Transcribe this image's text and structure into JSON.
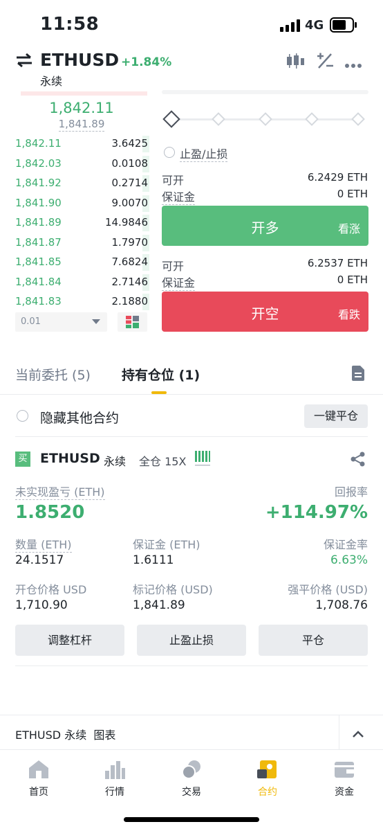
{
  "status_bar": {
    "time": "11:58",
    "network": "4G"
  },
  "header": {
    "pair": "ETHUSD",
    "change": "+1.84%",
    "subtitle": "永续"
  },
  "order_book": {
    "last_price": "1,842.11",
    "mark_price": "1,841.89",
    "bids": [
      {
        "price": "1,842.11",
        "qty": "3.6425",
        "depth": 0.05
      },
      {
        "price": "1,842.03",
        "qty": "0.0108",
        "depth": 0.05
      },
      {
        "price": "1,841.92",
        "qty": "0.2714",
        "depth": 0.05
      },
      {
        "price": "1,841.90",
        "qty": "9.0070",
        "depth": 0.05
      },
      {
        "price": "1,841.89",
        "qty": "14.9846",
        "depth": 0.05
      },
      {
        "price": "1,841.87",
        "qty": "1.7970",
        "depth": 0.05
      },
      {
        "price": "1,841.85",
        "qty": "7.6824",
        "depth": 0.05
      },
      {
        "price": "1,841.84",
        "qty": "2.7146",
        "depth": 0.05
      },
      {
        "price": "1,841.83",
        "qty": "2.1880",
        "depth": 0.05
      }
    ],
    "precision": "0.01"
  },
  "trade_panel": {
    "tpsl_label": "止盈/止损",
    "long": {
      "avail_label": "可开",
      "avail_value": "6.2429 ETH",
      "margin_label": "保证金",
      "margin_value": "0 ETH",
      "button": "开多",
      "hint": "看涨"
    },
    "short": {
      "avail_label": "可开",
      "avail_value": "6.2537 ETH",
      "margin_label": "保证金",
      "margin_value": "0 ETH",
      "button": "开空",
      "hint": "看跌"
    }
  },
  "tabs": {
    "orders": "当前委托 (5)",
    "positions": "持有仓位 (1)"
  },
  "filter": {
    "hide_label": "隐藏其他合约",
    "close_all": "一键平仓"
  },
  "position": {
    "side_badge": "买",
    "symbol": "ETHUSD",
    "type": "永续",
    "mode": "全仓 15X",
    "pnl_label": "未实现盈亏 (ETH)",
    "pnl_value": "1.8520",
    "roe_label": "回报率",
    "roe_value": "+114.97%",
    "size_label": "数量 (ETH)",
    "size_value": "24.1517",
    "margin_label": "保证金 (ETH)",
    "margin_value": "1.6111",
    "margin_ratio_label": "保证金率",
    "margin_ratio_value": "6.63%",
    "entry_label": "开仓价格 USD",
    "entry_value": "1,710.90",
    "mark_label": "标记价格 (USD)",
    "mark_value": "1,841.89",
    "liq_label": "强平价格 (USD)",
    "liq_value": "1,708.76",
    "btn_leverage": "调整杠杆",
    "btn_tpsl": "止盈止损",
    "btn_close": "平仓"
  },
  "chart_bar": {
    "label": "ETHUSD 永续  图表"
  },
  "bottom_nav": [
    {
      "label": "首页",
      "icon": "home-icon"
    },
    {
      "label": "行情",
      "icon": "markets-icon"
    },
    {
      "label": "交易",
      "icon": "trade-icon"
    },
    {
      "label": "合约",
      "icon": "futures-icon"
    },
    {
      "label": "资金",
      "icon": "wallet-icon"
    }
  ],
  "colors": {
    "green": "#3dae70",
    "red": "#e84a5a",
    "accent": "#f0b90b"
  }
}
